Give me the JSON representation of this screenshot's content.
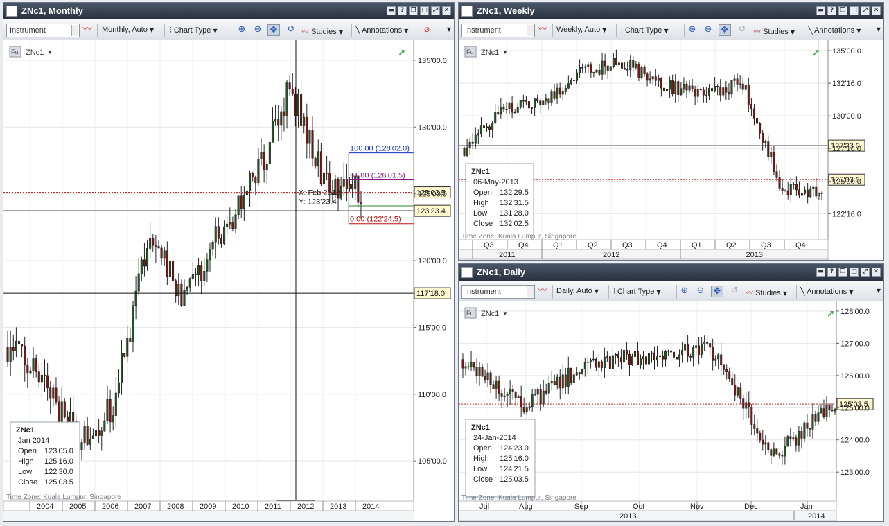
{
  "toolbar": {
    "instrument_placeholder": "Instrument",
    "chart_type": "Chart Type",
    "studies": "Studies",
    "annotations": "Annotations"
  },
  "colors": {
    "up": "#1f5a1f",
    "down": "#8b1010",
    "title_bar": "#2a3140"
  },
  "windows": {
    "monthly": {
      "title": "ZNc1, Monthly",
      "interval": "Monthly,  Auto",
      "symbol": "ZNc1",
      "badge": "Fu",
      "timezone": "Time Zone: Kuala Lumpur, Singapore",
      "y_ticks": [
        "135'00.0",
        "130'00.0",
        "125'00.0",
        "120'00.0",
        "115'00.0",
        "110'00.0",
        "105'00.0"
      ],
      "x_ticks": [
        "2004",
        "2005",
        "2006",
        "2007",
        "2008",
        "2009",
        "2010",
        "2011",
        "2012",
        "2013",
        "2014"
      ],
      "price_tags": [
        "125'03.5",
        "123'23.4",
        "117'18.0"
      ],
      "cursor_tag": "Feb 2012",
      "crosshair_x": "X: Feb 2012",
      "crosshair_y": "Y: 123'23.4",
      "fib_levels": [
        "100.00 (128'02.0)",
        "61.80 (126'01.5)",
        "0.00 (122'24.5)"
      ],
      "legend": {
        "title": "ZNc1",
        "date": "Jan 2014",
        "rows": [
          [
            "Open",
            "123'05.0"
          ],
          [
            "High",
            "125'16.0"
          ],
          [
            "Low",
            "122'30.0"
          ],
          [
            "Close",
            "125'03.5"
          ]
        ]
      }
    },
    "weekly": {
      "title": "ZNc1, Weekly",
      "interval": "Weekly,  Auto",
      "symbol": "ZNc1",
      "badge": "Fu",
      "timezone": "Time Zone: Kuala Lumpur, Singapore",
      "y_ticks": [
        "135'00.0",
        "132'16.0",
        "130'00.0",
        "127'16.0",
        "125'00.0",
        "122'16.0"
      ],
      "x_ticks": [
        "Q3",
        "Q4",
        "Q1",
        "Q2",
        "Q3",
        "Q4",
        "Q1",
        "Q2",
        "Q3",
        "Q4"
      ],
      "x_years": [
        "2011",
        "2012",
        "2013"
      ],
      "price_tags": [
        "127'23.0",
        "125'03.5"
      ],
      "legend": {
        "title": "ZNc1",
        "date": "06-May-2013",
        "rows": [
          [
            "Open",
            "132'29.5"
          ],
          [
            "High",
            "132'31.5"
          ],
          [
            "Low",
            "131'28.0"
          ],
          [
            "Close",
            "132'02.5"
          ]
        ]
      }
    },
    "daily": {
      "title": "ZNc1, Daily",
      "interval": "Daily,  Auto",
      "symbol": "ZNc1",
      "badge": "Fu",
      "timezone": "Time Zone: Kuala Lumpur, Singapore",
      "y_ticks": [
        "128'00.0",
        "127'00.0",
        "126'00.0",
        "125'00.0",
        "124'00.0",
        "123'00.0"
      ],
      "x_ticks": [
        "Jul",
        "Aug",
        "Sep",
        "Oct",
        "Nov",
        "Dec",
        "Jan"
      ],
      "x_years": [
        "2013",
        "2014"
      ],
      "price_tags": [
        "125'03.5"
      ],
      "legend": {
        "title": "ZNc1",
        "date": "24-Jan-2014",
        "rows": [
          [
            "Open",
            "124'23.0"
          ],
          [
            "High",
            "125'16.0"
          ],
          [
            "Low",
            "124'21.5"
          ],
          [
            "Close",
            "125'03.5"
          ]
        ]
      }
    }
  },
  "chart_data": [
    {
      "type": "candlestick",
      "title": "ZNc1, Monthly",
      "x": [
        "2004",
        "2005",
        "2006",
        "2007",
        "2008",
        "2009",
        "2010",
        "2011",
        "2012",
        "2013",
        "2014"
      ],
      "series": [
        {
          "values": [
            113.5,
            111.0,
            106.5,
            109.0,
            122.0,
            117.0,
            122.0,
            126.0,
            133.0,
            126.0,
            125.1
          ]
        }
      ],
      "ylim": [
        102,
        136.5
      ],
      "reference_lines": [
        125.11,
        123.73,
        117.56
      ]
    },
    {
      "type": "candlestick",
      "title": "ZNc1, Weekly",
      "x": [
        "Q3",
        "Q4",
        "Q1",
        "Q2",
        "Q3",
        "Q4",
        "Q1",
        "Q2",
        "Q3",
        "Q4"
      ],
      "series": [
        {
          "values": [
            127.5,
            130.5,
            131.0,
            133.5,
            134.0,
            132.5,
            131.5,
            132.5,
            124.5,
            124.0
          ]
        }
      ],
      "ylim": [
        120.5,
        135.8
      ],
      "reference_lines": [
        127.72,
        125.11
      ]
    },
    {
      "type": "candlestick",
      "title": "ZNc1, Daily",
      "x": [
        "Jul",
        "Aug",
        "Sep",
        "Oct",
        "Nov",
        "Dec",
        "Jan"
      ],
      "series": [
        {
          "values": [
            126.5,
            125.0,
            126.4,
            126.6,
            126.8,
            123.5,
            125.1
          ]
        }
      ],
      "ylim": [
        122.1,
        128.3
      ],
      "reference_lines": [
        125.11
      ]
    }
  ]
}
